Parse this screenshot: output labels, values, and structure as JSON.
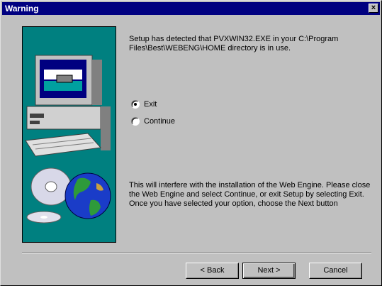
{
  "window": {
    "title": "Warning",
    "close_glyph": "×"
  },
  "message": "Setup has detected that PVXWIN32.EXE in your C:\\Program\nFiles\\Best\\WEBENG\\HOME directory is in use.",
  "options": [
    {
      "label": "Exit",
      "checked": true
    },
    {
      "label": "Continue",
      "checked": false
    }
  ],
  "info": "This will interfere with the installation of the Web Engine.  Please close the Web Engine and select Continue, or exit Setup by selecting Exit. Once you have selected your option, choose the Next button",
  "buttons": {
    "back": "< Back",
    "next": "Next >",
    "cancel": "Cancel"
  },
  "colors": {
    "title_bar": "#000080",
    "panel": "#008080",
    "face": "#c0c0c0"
  },
  "icons": [
    "computer-icon",
    "cd-disc-icon",
    "globe-icon",
    "close-icon"
  ]
}
